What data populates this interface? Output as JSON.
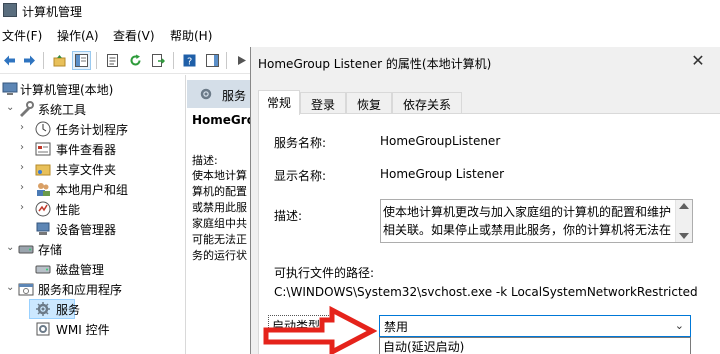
{
  "window": {
    "title": "计算机管理"
  },
  "menu": [
    "文件(F)",
    "操作(A)",
    "查看(V)",
    "帮助(H)"
  ],
  "toolbar": {
    "buttons": [
      "back-icon",
      "forward-icon",
      "up-folder-icon",
      "show-hide-tree-icon",
      "properties-icon",
      "refresh-icon",
      "export-list-icon",
      "help-icon",
      "show-hide-action-icon",
      "play-icon"
    ]
  },
  "tree": {
    "root": "计算机管理(本地)",
    "system_tools": "系统工具",
    "task_scheduler": "任务计划程序",
    "event_viewer": "事件查看器",
    "shared_folders": "共享文件夹",
    "local_users": "本地用户和组",
    "performance": "性能",
    "device_manager": "设备管理器",
    "storage": "存储",
    "disk_management": "磁盘管理",
    "services_apps": "服务和应用程序",
    "services": "服务",
    "wmi": "WMI 控件"
  },
  "center": {
    "header": "服务",
    "service_name": "HomeGro",
    "desc_label": "描述:",
    "desc_lines": [
      "使本地计算",
      "算机的配置",
      "或禁用此服",
      "家庭组中共",
      "可能无法正",
      "务的运行状"
    ]
  },
  "dialog": {
    "title": "HomeGroup Listener 的属性(本地计算机)",
    "close": "✕",
    "tabs": [
      "常规",
      "登录",
      "恢复",
      "依存关系"
    ],
    "service_name_label": "服务名称:",
    "service_name_value": "HomeGroupListener",
    "display_name_label": "显示名称:",
    "display_name_value": "HomeGroup Listener",
    "description_label": "描述:",
    "description_lines": [
      "使本地计算机更改与加入家庭组的计算机的配置和维护",
      "相关联。如果停止或禁用此服务，你的计算机将无法在"
    ],
    "exe_path_label": "可执行文件的路径:",
    "exe_path_value": "C:\\WINDOWS\\System32\\svchost.exe -k LocalSystemNetworkRestricted",
    "startup_type_label": "启动类型(E):",
    "startup_type_value": "禁用",
    "startup_options_visible": [
      "自动(延迟启动)"
    ]
  },
  "colors": {
    "selection": "#cce8ff",
    "center_header": "#d4dee8",
    "dialog_bg": "#f0f0f0",
    "focus_border": "#0078d7",
    "arrow_red": "#e5231b"
  }
}
